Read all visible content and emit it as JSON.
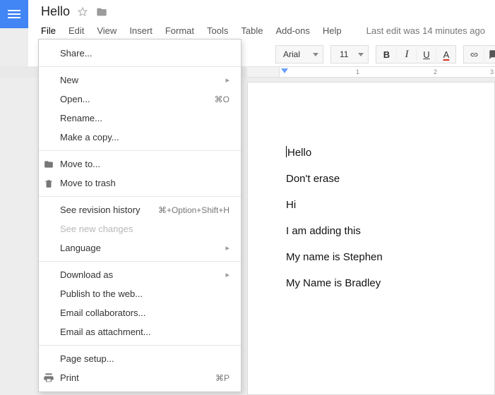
{
  "doc_title": "Hello",
  "menubar": {
    "file": "File",
    "edit": "Edit",
    "view": "View",
    "insert": "Insert",
    "format": "Format",
    "tools": "Tools",
    "table": "Table",
    "addons": "Add-ons",
    "help": "Help"
  },
  "last_edit": "Last edit was 14 minutes ago",
  "toolbar": {
    "font": "Arial",
    "size": "11",
    "bold": "B",
    "italic": "I",
    "underline": "U",
    "color": "A"
  },
  "ruler": {
    "n1": "1",
    "n2": "2",
    "n3": "3"
  },
  "file_menu": {
    "share": "Share...",
    "new": "New",
    "open": "Open...",
    "open_short": "⌘O",
    "rename": "Rename...",
    "make_copy": "Make a copy...",
    "move_to": "Move to...",
    "trash": "Move to trash",
    "revision": "See revision history",
    "revision_short": "⌘+Option+Shift+H",
    "new_changes": "See new changes",
    "language": "Language",
    "download": "Download as",
    "publish": "Publish to the web...",
    "email_collab": "Email collaborators...",
    "email_attach": "Email as attachment...",
    "page_setup": "Page setup...",
    "print": "Print",
    "print_short": "⌘P",
    "submenu_arrow": "▸"
  },
  "document": {
    "l1": "Hello",
    "l2": "Don't erase",
    "l3": "Hi",
    "l4": "I am adding this",
    "l5": "My name is Stephen",
    "l6": "My Name is Bradley"
  }
}
